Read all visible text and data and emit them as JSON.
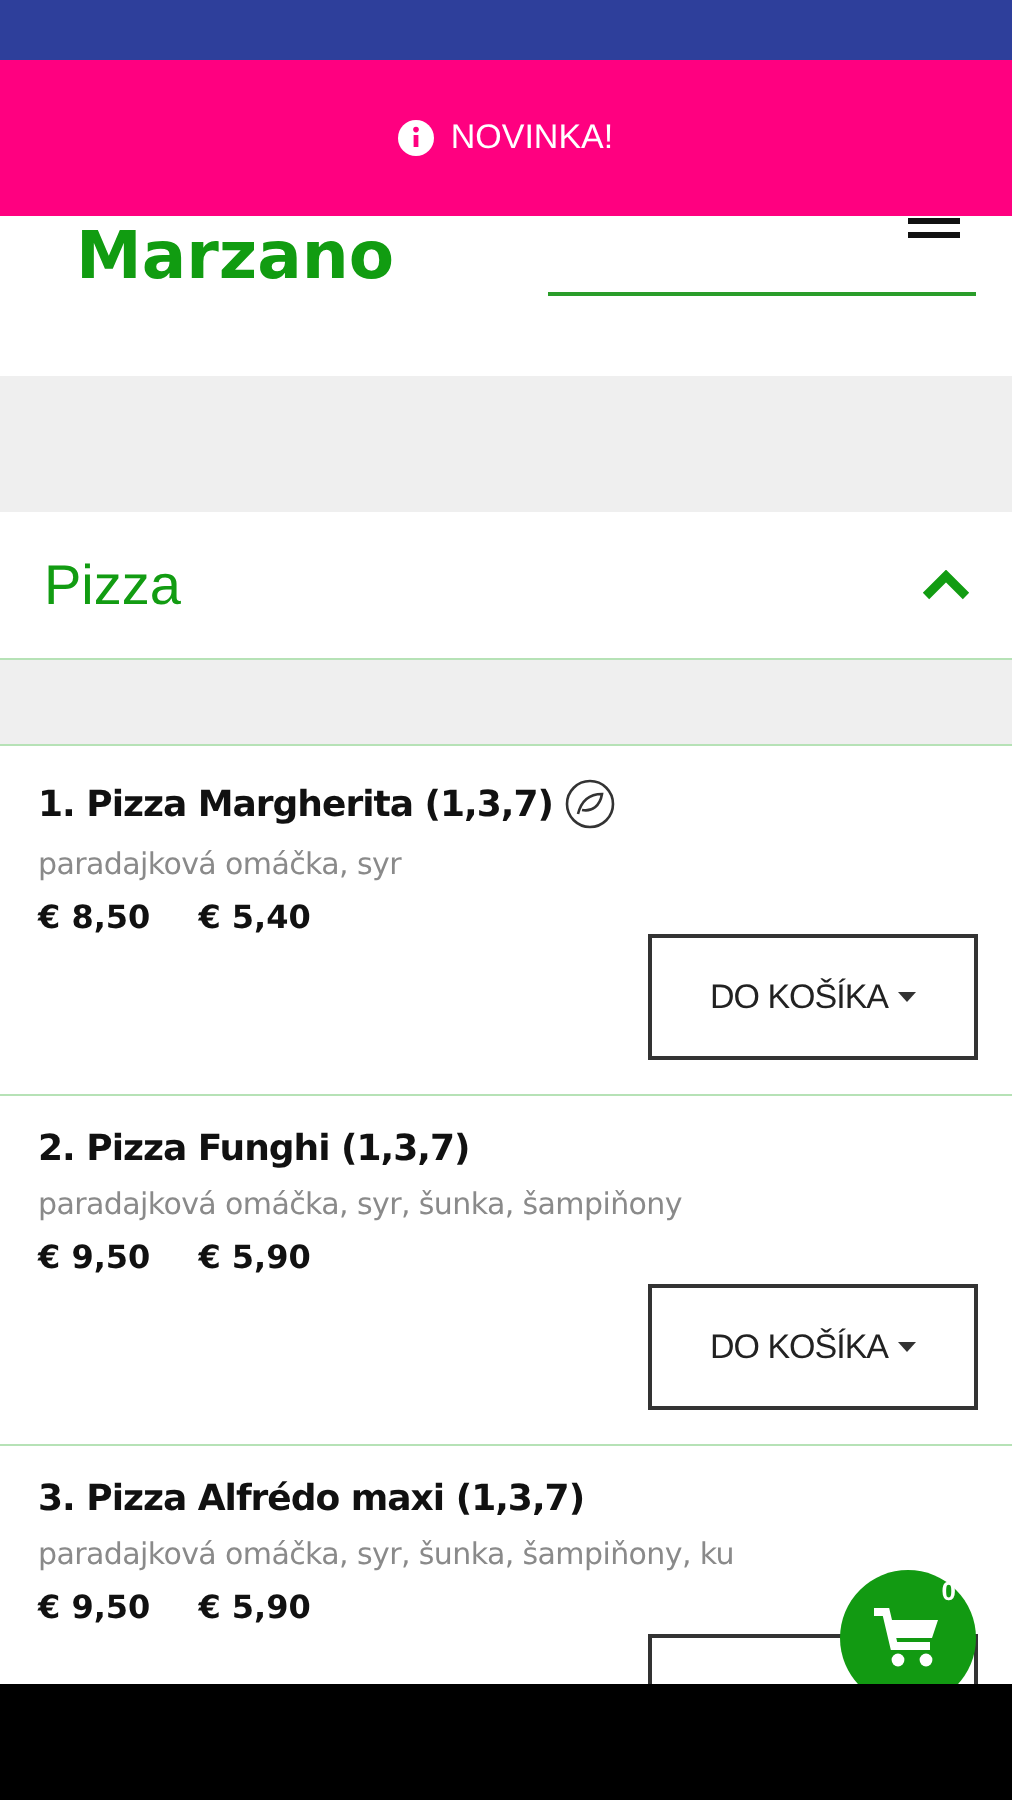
{
  "banner": {
    "text": "NOVINKA!"
  },
  "header": {
    "logo": "Marzano"
  },
  "section": {
    "title": "Pizza",
    "expanded": true
  },
  "items": [
    {
      "name": "1. Pizza Margherita (1,3,7)",
      "vegetarian": true,
      "description": "paradajková omáčka, syr",
      "prices": [
        "€ 8,50",
        "€ 5,40"
      ],
      "button": "DO KOŠÍKA"
    },
    {
      "name": "2. Pizza Funghi (1,3,7)",
      "vegetarian": false,
      "description": "paradajková omáčka, syr, šunka, šampiňony",
      "prices": [
        "€ 9,50",
        "€ 5,90"
      ],
      "button": "DO KOŠÍKA"
    },
    {
      "name": "3. Pizza Alfrédo maxi (1,3,7)",
      "vegetarian": false,
      "description": "paradajková omáčka, syr, šunka, šampiňony, ku",
      "prices": [
        "€ 9,50",
        "€ 5,90"
      ]
    }
  ],
  "cart": {
    "count": "0"
  }
}
